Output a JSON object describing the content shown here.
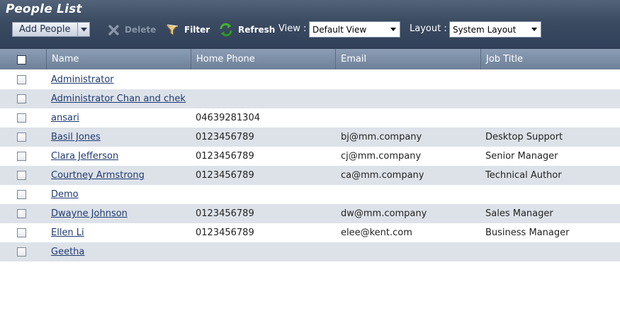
{
  "header": {
    "title": "People List",
    "add_label": "Add People",
    "delete_label": "Delete",
    "filter_label": "Filter",
    "refresh_label": "Refresh",
    "view_label": "View :",
    "view_value": "Default View",
    "layout_label": "Layout :",
    "layout_value": "System Layout"
  },
  "columns": [
    "Name",
    "Home Phone",
    "Email",
    "Job Title"
  ],
  "rows": [
    {
      "name": "Administrator",
      "phone": "",
      "email": "",
      "job": ""
    },
    {
      "name": "Administrator Chan and chek",
      "phone": "",
      "email": "",
      "job": ""
    },
    {
      "name": "ansari",
      "phone": "04639281304",
      "email": "",
      "job": ""
    },
    {
      "name": "Basil Jones",
      "phone": "0123456789",
      "email": "bj@mm.company",
      "job": "Desktop Support"
    },
    {
      "name": "Clara Jefferson",
      "phone": "0123456789",
      "email": "cj@mm.company",
      "job": "Senior Manager"
    },
    {
      "name": "Courtney Armstrong",
      "phone": "0123456789",
      "email": "ca@mm.company",
      "job": "Technical Author"
    },
    {
      "name": "Demo",
      "phone": "",
      "email": "",
      "job": ""
    },
    {
      "name": "Dwayne Johnson",
      "phone": "0123456789",
      "email": "dw@mm.company",
      "job": "Sales Manager"
    },
    {
      "name": "Ellen Li",
      "phone": "0123456789",
      "email": "elee@kent.com",
      "job": "Business Manager"
    },
    {
      "name": "Geetha",
      "phone": "",
      "email": "",
      "job": ""
    }
  ],
  "colors": {
    "header": "#3b4b61",
    "grid_header": "#7f90a8",
    "alt_row": "#dde2e9",
    "link": "#1f3a70"
  },
  "icons": [
    "chevron-down-icon",
    "delete-x-icon",
    "filter-funnel-icon",
    "refresh-arrows-icon"
  ]
}
